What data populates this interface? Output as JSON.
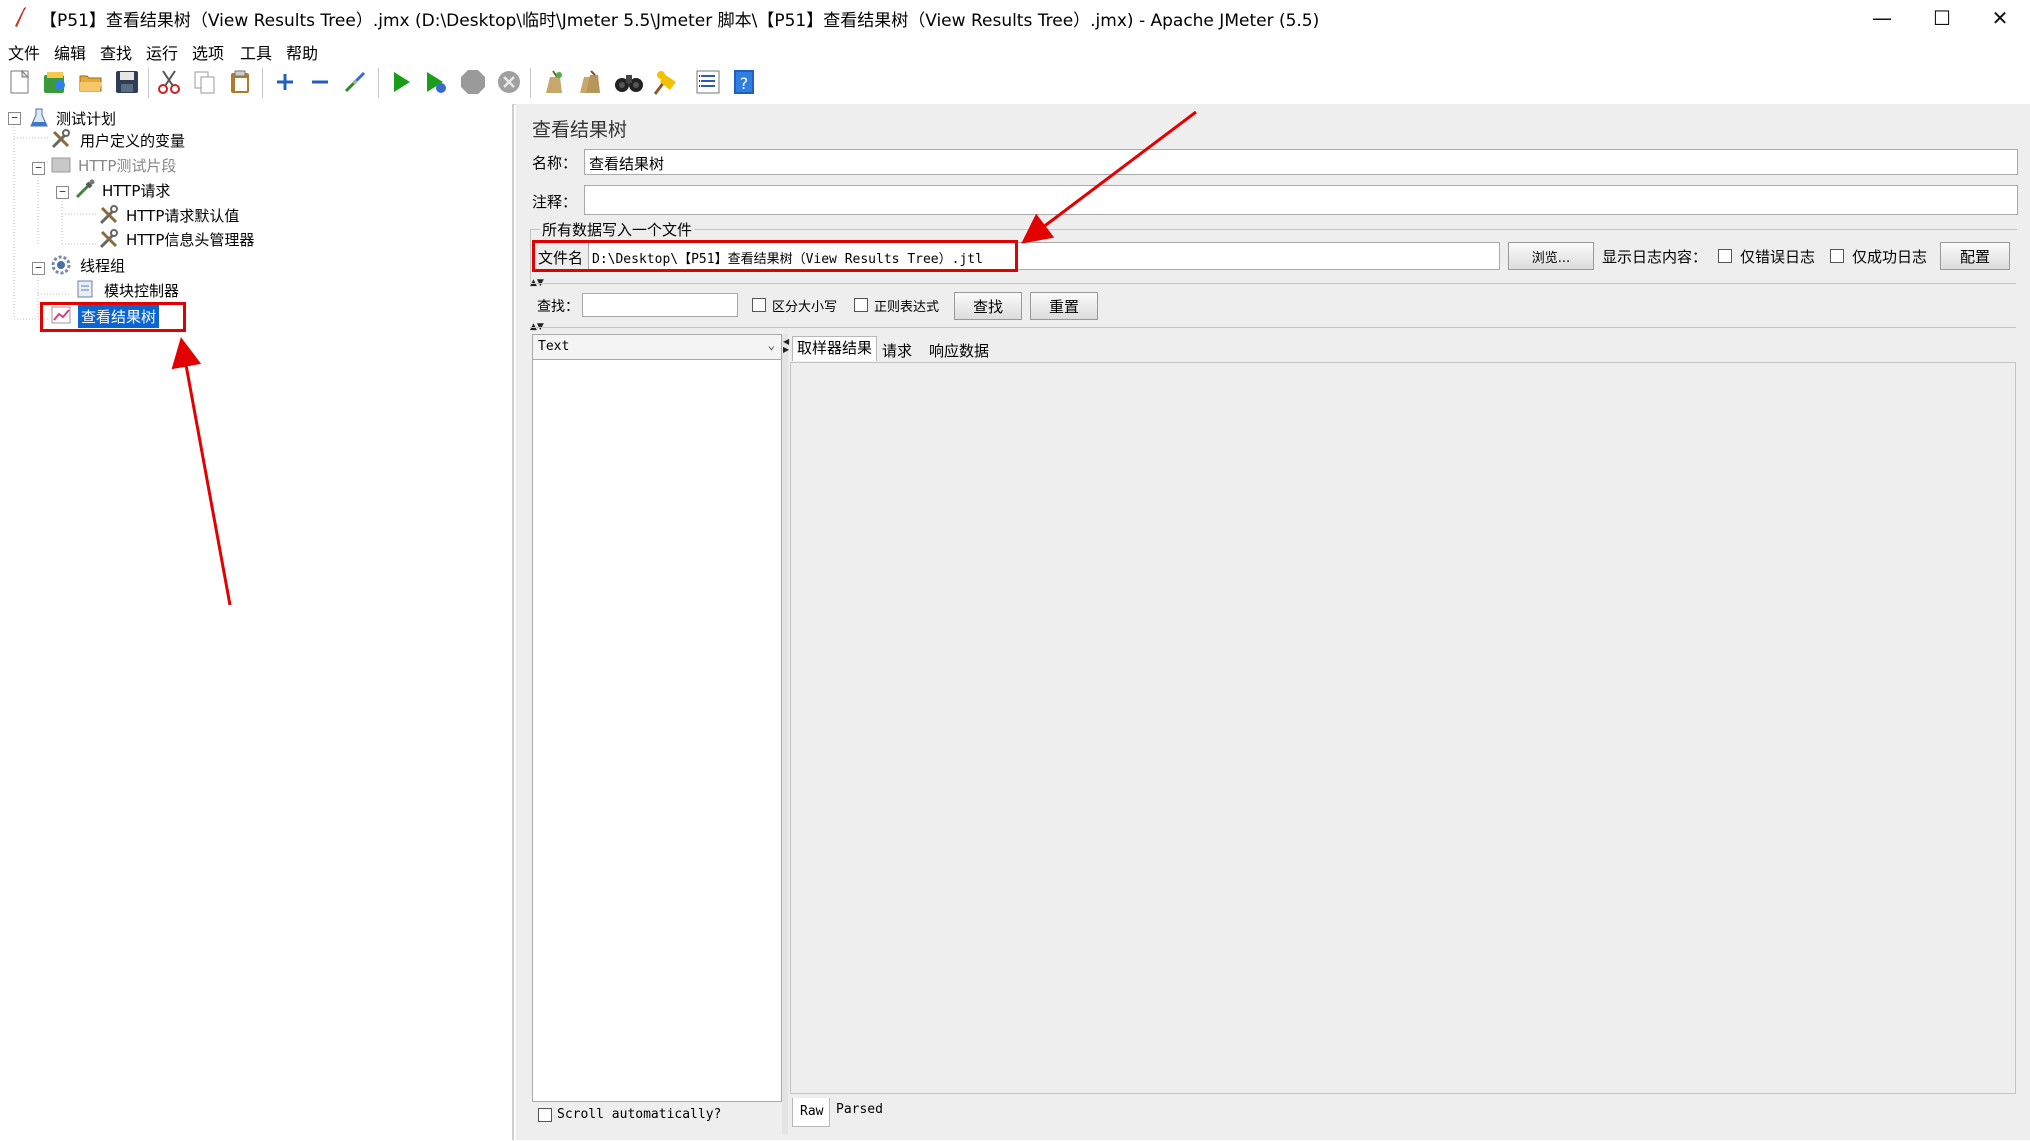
{
  "window": {
    "title": "【P51】查看结果树（View Results Tree）.jmx (D:\\Desktop\\临时\\Jmeter 5.5\\Jmeter 脚本\\【P51】查看结果树（View Results Tree）.jmx) - Apache JMeter (5.5)",
    "minimize": "—",
    "maximize": "☐",
    "close": "✕"
  },
  "menu": [
    "文件",
    "编辑",
    "查找",
    "运行",
    "选项",
    "工具",
    "帮助"
  ],
  "tree": {
    "items": [
      {
        "label": "测试计划",
        "icon": "flask-icon"
      },
      {
        "label": "用户定义的变量",
        "icon": "wrench-icon"
      },
      {
        "label": "HTTP测试片段",
        "icon": "fragment-icon"
      },
      {
        "label": "HTTP请求",
        "icon": "pipette-icon"
      },
      {
        "label": "HTTP请求默认值",
        "icon": "wrench-icon"
      },
      {
        "label": "HTTP信息头管理器",
        "icon": "wrench-icon"
      },
      {
        "label": "线程组",
        "icon": "gear-icon"
      },
      {
        "label": "模块控制器",
        "icon": "module-icon"
      },
      {
        "label": "查看结果树",
        "icon": "chart-icon"
      }
    ],
    "selected": "查看结果树"
  },
  "panel": {
    "heading": "查看结果树",
    "name_label": "名称：",
    "name_value": "查看结果树",
    "comment_label": "注释：",
    "comment_value": "",
    "file_group_label": "所有数据写入一个文件",
    "filename_label": "文件名",
    "filename_value": "D:\\Desktop\\【P51】查看结果树（View Results Tree）.jtl",
    "browse_button": "浏览...",
    "log_content_label": "显示日志内容：",
    "errors_only": "仅错误日志",
    "success_only": "仅成功日志",
    "configure_button": "配置",
    "search_label": "查找：",
    "search_value": "",
    "case_sensitive": "区分大小写",
    "regex": "正则表达式",
    "find_button": "查找",
    "reset_button": "重置",
    "renderer_select": "Text",
    "tabs": [
      "取样器结果",
      "请求",
      "响应数据"
    ],
    "scroll_auto": "Scroll automatically?",
    "bottom_tabs": [
      "Raw",
      "Parsed"
    ]
  },
  "colors": {
    "selection": "#0a64d2",
    "annotation": "#e30000",
    "run_green": "#1a9e1a"
  }
}
